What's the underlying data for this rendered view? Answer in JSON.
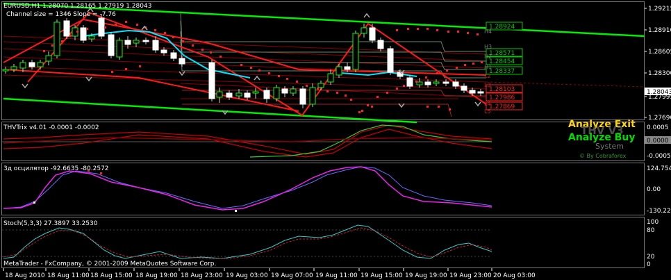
{
  "header": {
    "symbol_line": "EURUSD,H1  1.28070 1.28165 1.27919 1.28043",
    "channel_line": "Channel size = 1346  Slope = -7.76"
  },
  "price_axis": {
    "labels": [
      "1.29215",
      "1.28910",
      "1.28605",
      "1.28300",
      "1.27995",
      "1.27690"
    ],
    "current_price": "1.28043"
  },
  "level_boxes": [
    {
      "text": "1.28924",
      "color": "#00cc00"
    },
    {
      "text": "1.28571",
      "color": "#00cc00"
    },
    {
      "text": "1.28454",
      "color": "#00cc00"
    },
    {
      "text": "1.28337",
      "color": "#00cc00"
    },
    {
      "text": "1.28103",
      "color": "#ff2222"
    },
    {
      "text": "1.27986",
      "color": "#ff2222"
    },
    {
      "text": "1.27869",
      "color": "#ff2222"
    }
  ],
  "level_tags": [
    "H4",
    "H3",
    "H2",
    "H1",
    "L2",
    "L3",
    "L4",
    "L5"
  ],
  "thv_panel": {
    "title": "THVTrix v4.01 -0.0001 -0.0002",
    "axis": [
      "0.0005",
      "0.0000",
      "-0.0005"
    ],
    "overlay_exit": "Analyze Exit",
    "overlay_thv": "THV V3",
    "overlay_buy": "Analyze Buy",
    "overlay_system": "System",
    "overlay_credit": "© By Cobraforex"
  },
  "osc_panel": {
    "title": "3д осцилятор -92.6635 -80.2572",
    "axis": [
      "124.7541",
      "0.00",
      "-130.2217"
    ]
  },
  "stoch_panel": {
    "title": "Stoch(5,3,3) 27.3897 33.2530",
    "axis": [
      "100",
      "80",
      "20",
      "0"
    ]
  },
  "footer": {
    "copyright": "MetaTrader - FxCompany, © 2001-2009 MetaQuotes Software Corp."
  },
  "time_axis": {
    "labels": [
      "18 Aug 2010",
      "18 Aug 11:00",
      "18 Aug 15:00",
      "18 Aug 19:00",
      "18 Aug 23:00",
      "19 Aug 03:00",
      "19 Aug 07:00",
      "19 Aug 11:00",
      "19 Aug 15:00",
      "19 Aug 19:00",
      "19 Aug 23:00",
      "20 Aug 03:00"
    ]
  },
  "colors": {
    "background": "#000000",
    "bull_candle": "#00ff00",
    "bear_candle": "#ffffff",
    "channel_line": "#00ff00",
    "trend_line": "#ff0000",
    "ma_line": "#00e5ff",
    "exit_text": "#ffd700",
    "buy_text": "#00ff00"
  }
}
